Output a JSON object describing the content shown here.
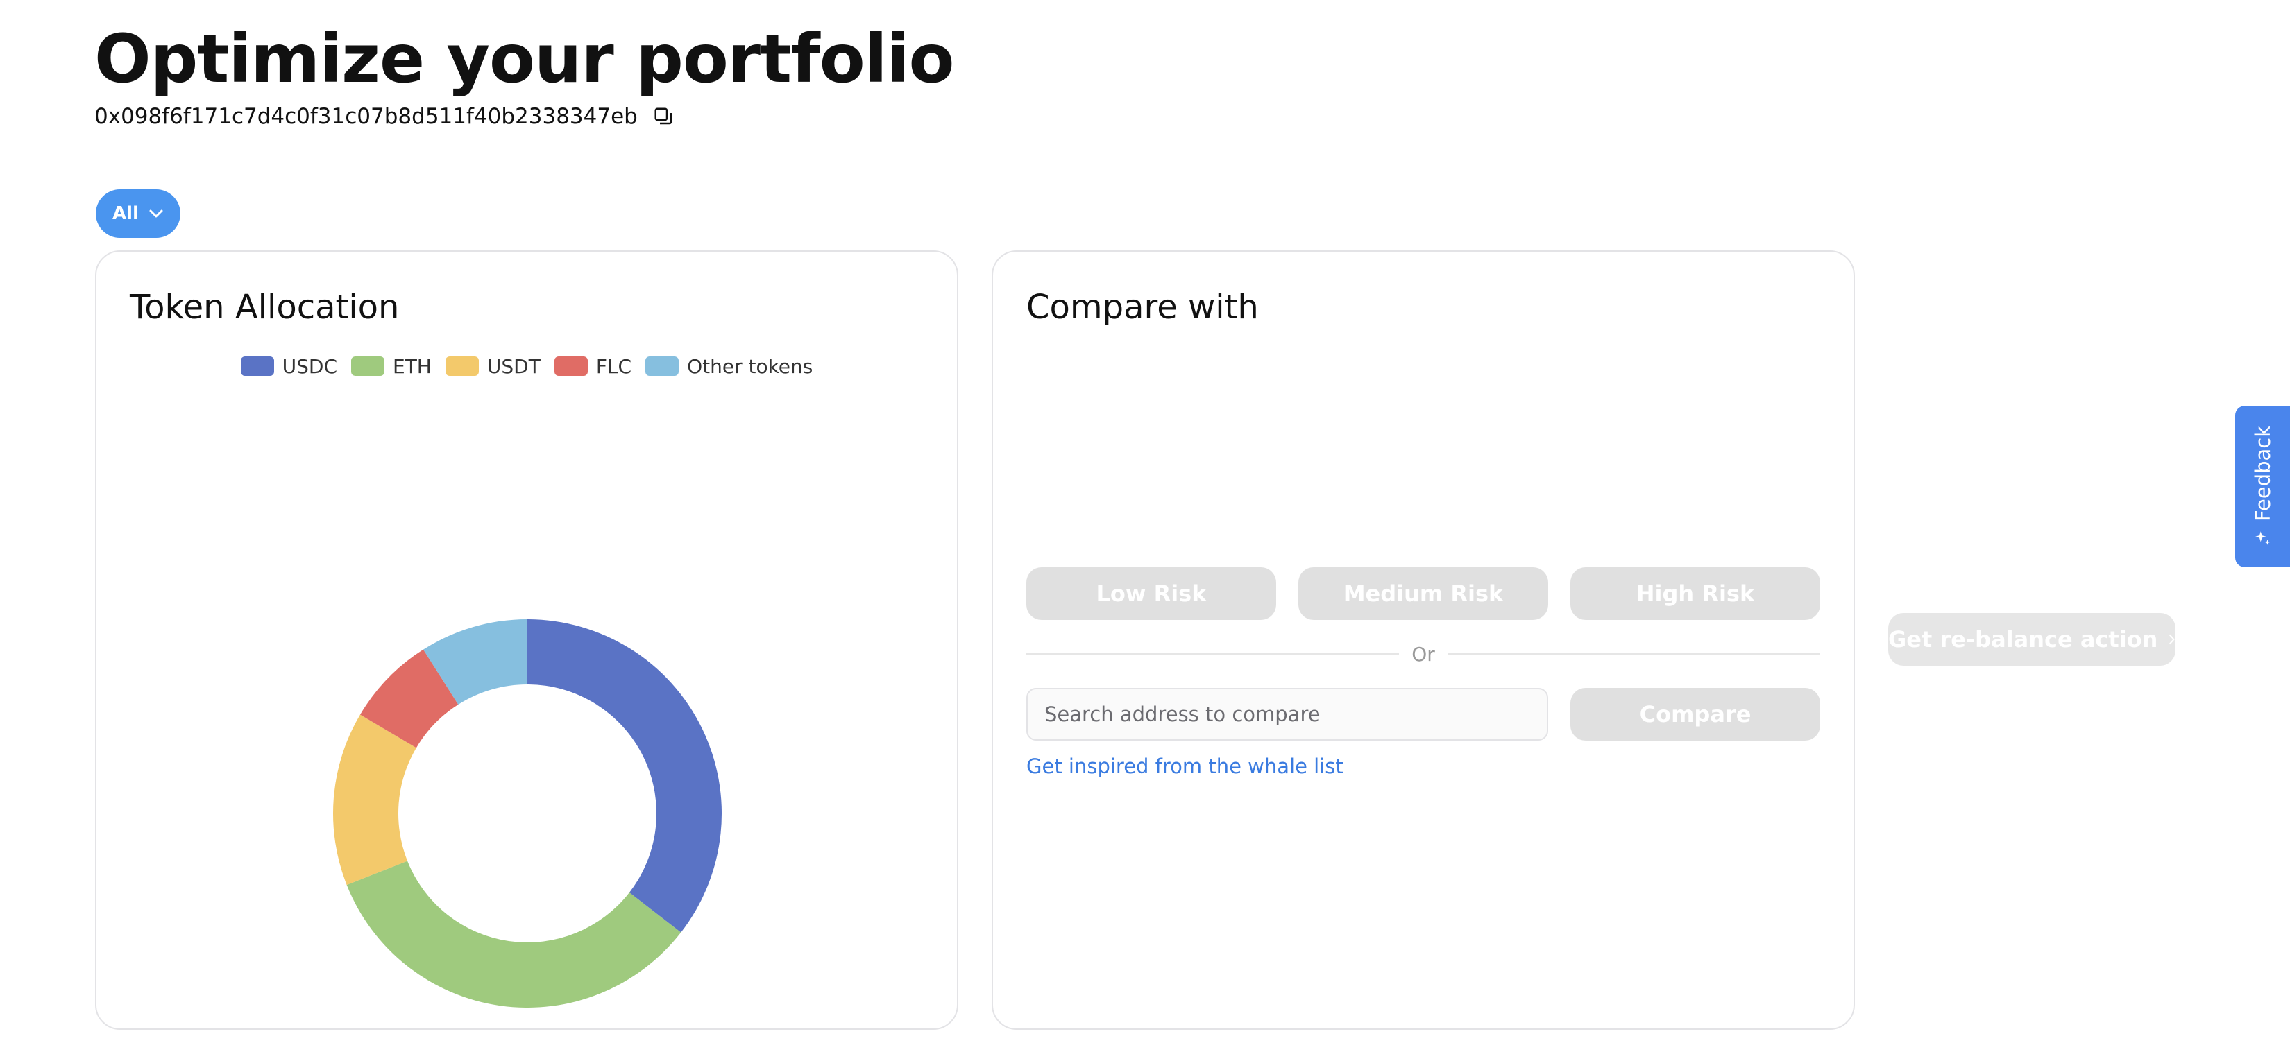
{
  "header": {
    "title": "Optimize your portfolio",
    "address": "0x098f6f171c7d4c0f31c07b8d511f40b2338347eb"
  },
  "filter": {
    "selected": "All"
  },
  "token_allocation": {
    "title": "Token Allocation",
    "legend": [
      {
        "label": "USDC",
        "color": "#5a73c5"
      },
      {
        "label": "ETH",
        "color": "#9fca7e"
      },
      {
        "label": "USDT",
        "color": "#f3c96b"
      },
      {
        "label": "FLC",
        "color": "#e06c65"
      },
      {
        "label": "Other tokens",
        "color": "#86bfdf"
      }
    ]
  },
  "chart_data": {
    "type": "pie",
    "donut": true,
    "categories": [
      "USDC",
      "ETH",
      "USDT",
      "FLC",
      "Other tokens"
    ],
    "values": [
      35.5,
      33.5,
      14.5,
      7.5,
      9.0
    ],
    "colors": [
      "#5a73c5",
      "#9fca7e",
      "#f3c96b",
      "#e06c65",
      "#86bfdf"
    ],
    "legend_position": "top"
  },
  "compare": {
    "title": "Compare with",
    "risk_buttons": [
      "Low Risk",
      "Medium Risk",
      "High Risk"
    ],
    "divider_text": "Or",
    "search_placeholder": "Search address to compare",
    "compare_label": "Compare",
    "whale_link": "Get inspired from the whale list"
  },
  "rebalance": {
    "label": "Get re-balance action"
  },
  "feedback": {
    "label": "Feedback"
  }
}
